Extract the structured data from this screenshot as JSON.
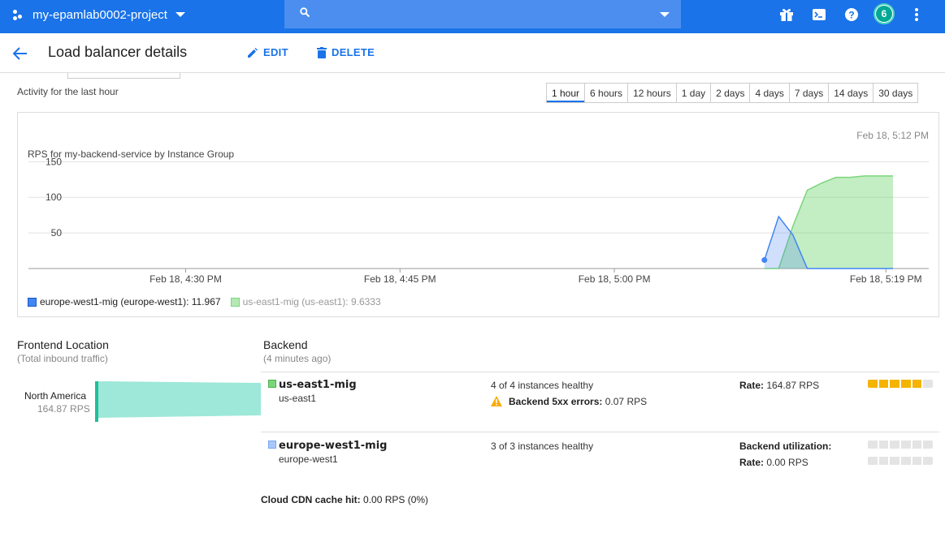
{
  "topbar": {
    "project_name": "my-epamlab0002-project",
    "search_placeholder": "",
    "avatar_initial": "6",
    "icons": [
      "gift-icon",
      "cloud-shell-icon",
      "help-icon",
      "more-vert-icon"
    ]
  },
  "header": {
    "title": "Load balancer details",
    "edit_label": "EDIT",
    "delete_label": "DELETE"
  },
  "activity": {
    "label": "Activity for the last hour",
    "ranges": [
      "1 hour",
      "6 hours",
      "12 hours",
      "1 day",
      "2 days",
      "4 days",
      "7 days",
      "14 days",
      "30 days"
    ],
    "active_range": "1 hour"
  },
  "chart": {
    "timestamp": "Feb 18, 5:12 PM",
    "title": "RPS for my-backend-service by Instance Group",
    "legend": [
      {
        "label": "europe-west1-mig (europe-west1): 11.967",
        "color": "#4285f4"
      },
      {
        "label": "us-east1-mig (us-east1): 9.6333",
        "color": "#7bd67b"
      }
    ]
  },
  "chart_data": {
    "type": "area",
    "title": "RPS for my-backend-service by Instance Group",
    "y_ticks": [
      "150",
      "100",
      "50"
    ],
    "x_ticks": [
      "Feb 18, 4:30 PM",
      "Feb 18, 4:45 PM",
      "Feb 18, 5:00 PM",
      "Feb 18, 5:19 PM"
    ],
    "x_minutes": [
      0,
      15,
      30,
      49
    ],
    "ylim": [
      0,
      180
    ],
    "xlim_minutes": [
      -11,
      52
    ],
    "grid": true,
    "series": [
      {
        "name": "europe-west1-mig (europe-west1): 11.967",
        "color": "#4285f4",
        "x": [
          40.5,
          41.5,
          42.5,
          43.5,
          44.5,
          45.5,
          46.5,
          47.5,
          48.5,
          49.5
        ],
        "y": [
          12,
          73,
          47,
          0,
          0,
          0,
          0,
          0,
          0,
          0
        ]
      },
      {
        "name": "us-east1-mig (us-east1): 9.6333",
        "color": "#7bd67b",
        "x": [
          40.5,
          41.5,
          42.5,
          43.5,
          44.5,
          45.5,
          46.5,
          47.5,
          48.5,
          49.5
        ],
        "y": [
          0,
          0,
          60,
          110,
          120,
          128,
          128,
          130,
          130,
          130
        ]
      }
    ]
  },
  "frontend": {
    "title": "Frontend Location",
    "subtitle": "(Total inbound traffic)",
    "location": "North America",
    "rps": "164.87 RPS"
  },
  "backend": {
    "title": "Backend",
    "subtitle": "(4 minutes ago)",
    "items": [
      {
        "name": "us-east1-mig",
        "region": "us-east1",
        "health": "4 of 4 instances healthy",
        "error_label": "Backend 5xx errors:",
        "error_value": "0.07 RPS",
        "rate_label": "Rate:",
        "rate_value": "164.87 RPS",
        "color": "#7bd67b",
        "meter_fill": 0.95
      },
      {
        "name": "europe-west1-mig",
        "region": "europe-west1",
        "health": "3 of 3 instances healthy",
        "util_label": "Backend utilization:",
        "rate_label": "Rate:",
        "rate_value": "0.00 RPS",
        "color": "#a8c7fa",
        "meter_fill": 0
      }
    ],
    "cdn_label": "Cloud CDN cache hit:",
    "cdn_value": "0.00 RPS (0%)"
  }
}
